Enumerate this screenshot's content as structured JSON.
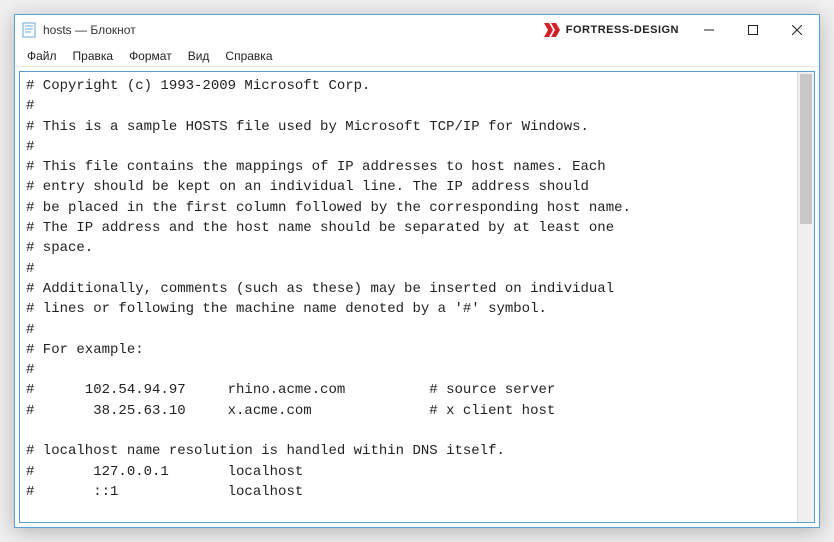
{
  "window": {
    "title": "hosts — Блокнот",
    "brand": "FORTRESS-DESIGN"
  },
  "menu": {
    "file": "Файл",
    "edit": "Правка",
    "format": "Формат",
    "view": "Вид",
    "help": "Справка"
  },
  "lines": {
    "l0": "# Copyright (c) 1993-2009 Microsoft Corp.",
    "l1": "#",
    "l2": "# This is a sample HOSTS file used by Microsoft TCP/IP for Windows.",
    "l3": "#",
    "l4": "# This file contains the mappings of IP addresses to host names. Each",
    "l5": "# entry should be kept on an individual line. The IP address should",
    "l6": "# be placed in the first column followed by the corresponding host name.",
    "l7": "# The IP address and the host name should be separated by at least one",
    "l8": "# space.",
    "l9": "#",
    "l10": "# Additionally, comments (such as these) may be inserted on individual",
    "l11": "# lines or following the machine name denoted by a '#' symbol.",
    "l12": "#",
    "l13": "# For example:",
    "l14": "#",
    "l15": "#      102.54.94.97     rhino.acme.com          # source server",
    "l16": "#       38.25.63.10     x.acme.com              # x client host",
    "l17": "",
    "l18": "# localhost name resolution is handled within DNS itself.",
    "l19": "#       127.0.0.1       localhost",
    "l20": "#       ::1             localhost",
    "l21": ""
  }
}
